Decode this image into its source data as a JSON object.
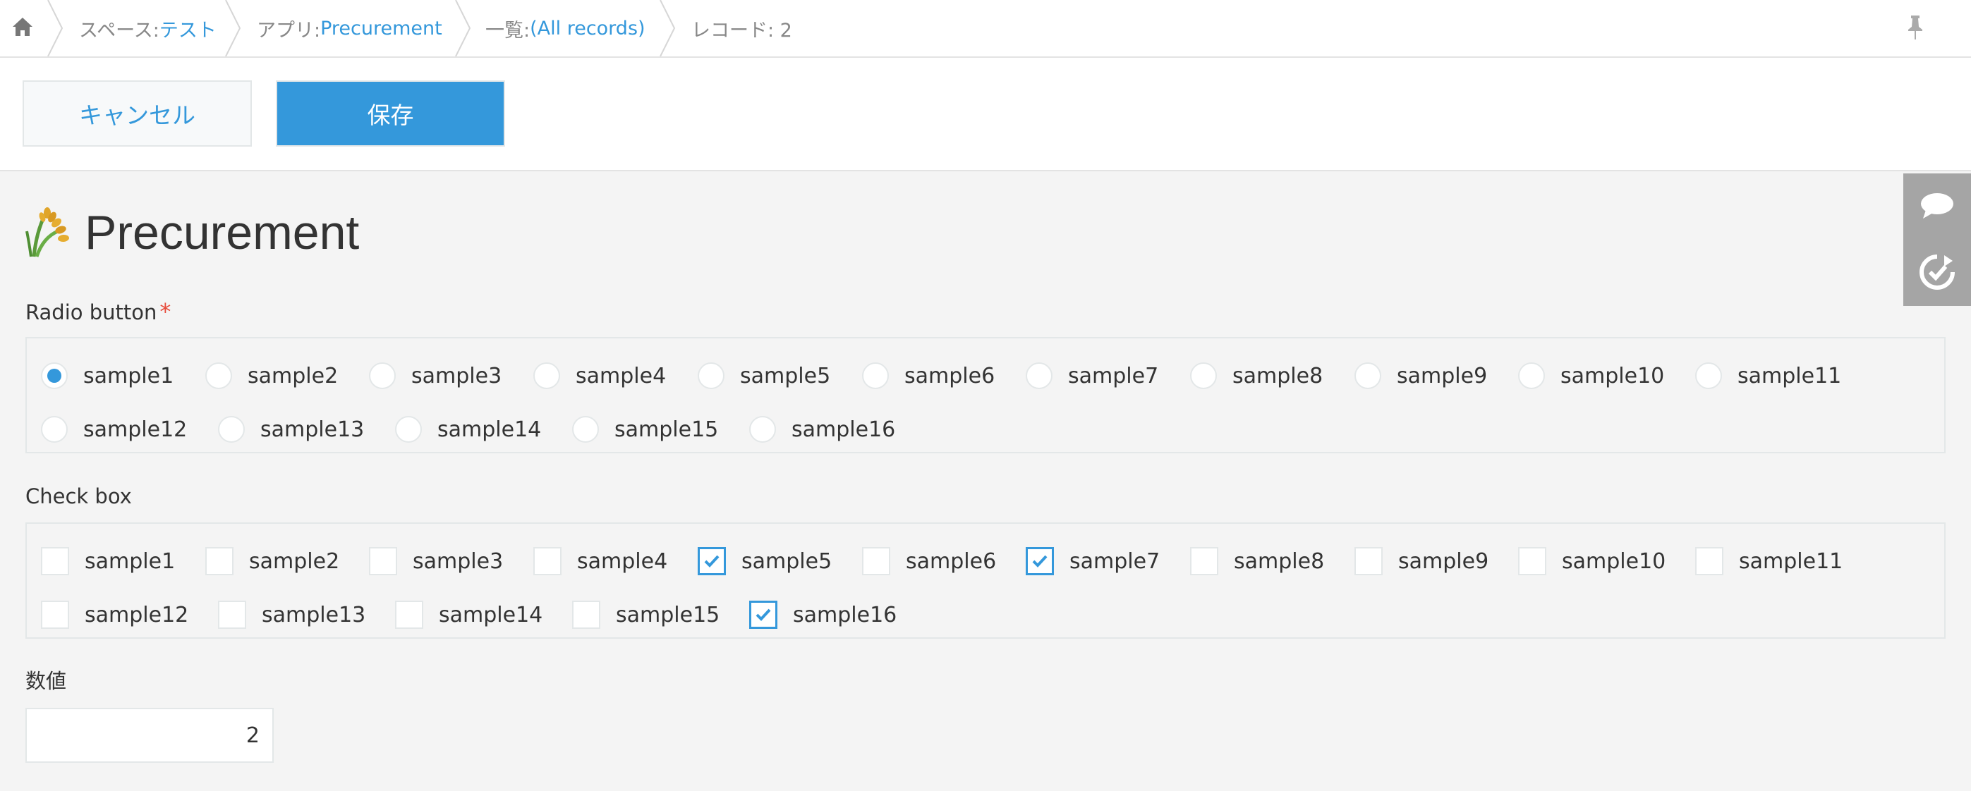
{
  "breadcrumb": {
    "space_prefix": "スペース: ",
    "space_value": "テスト",
    "app_prefix": "アプリ: ",
    "app_value": "Precurement",
    "list_prefix": "一覧: ",
    "list_value": "(All records)",
    "record": "レコード: 2",
    "home_icon": "home-icon",
    "pin_icon": "pin-icon"
  },
  "toolbar": {
    "cancel_label": "キャンセル",
    "save_label": "保存"
  },
  "side_panel": {
    "icons": [
      "comment-icon",
      "history-icon"
    ]
  },
  "app": {
    "title": "Precurement",
    "icon": "rice-plant-icon"
  },
  "form": {
    "radio": {
      "label": "Radio button",
      "required_mark": "*",
      "options": [
        "sample1",
        "sample2",
        "sample3",
        "sample4",
        "sample5",
        "sample6",
        "sample7",
        "sample8",
        "sample9",
        "sample10",
        "sample11",
        "sample12",
        "sample13",
        "sample14",
        "sample15",
        "sample16"
      ],
      "selected": "sample1"
    },
    "checkbox": {
      "label": "Check box",
      "options": [
        "sample1",
        "sample2",
        "sample3",
        "sample4",
        "sample5",
        "sample6",
        "sample7",
        "sample8",
        "sample9",
        "sample10",
        "sample11",
        "sample12",
        "sample13",
        "sample14",
        "sample15",
        "sample16"
      ],
      "checked": [
        "sample5",
        "sample7",
        "sample16"
      ]
    },
    "number": {
      "label": "数値",
      "value": "2"
    }
  },
  "colors": {
    "accent": "#3498db",
    "required": "#e74c3c",
    "background": "#f4f4f4"
  }
}
